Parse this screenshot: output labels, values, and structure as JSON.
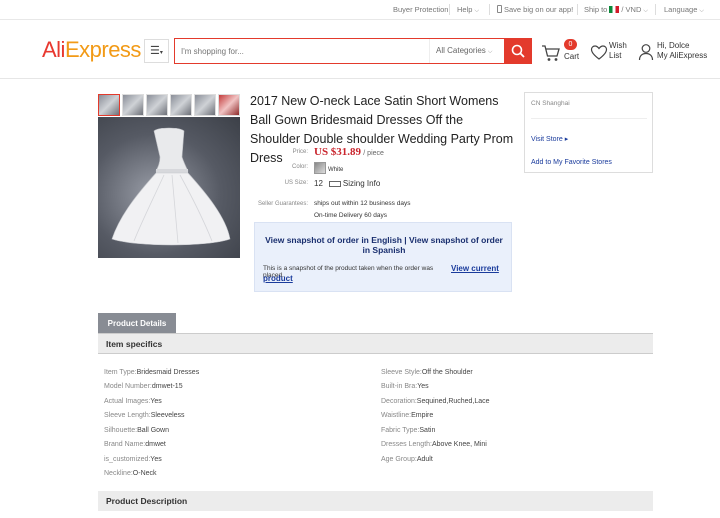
{
  "topbar": {
    "buyer_protection": "Buyer Protection",
    "help": "Help",
    "app_promo": "Save big on our app!",
    "ship_to": "Ship to",
    "ship_to_value": "/ VND",
    "language": "Language"
  },
  "header": {
    "logo_ali": "Ali",
    "logo_express": "Express",
    "category_icon": "menu-icon",
    "search_placeholder": "I'm shopping for...",
    "search_category": "All Categories",
    "cart_count": "0",
    "cart_label": "Cart",
    "wish_line1": "Wish",
    "wish_line2": "List",
    "user_greeting": "Hi, Dolce",
    "user_account": "My AliExpress"
  },
  "product": {
    "title": "2017 New O-neck Lace Satin Short Womens Ball Gown Bridesmaid Dresses Off the Shoulder Double shoulder Wedding Party Prom Dress",
    "price_label": "Price:",
    "price": "US $31.89",
    "price_unit": "/ piece",
    "color_label": "Color:",
    "color_value": "White",
    "size_label": "US Size:",
    "size_value": "12",
    "sizing_info": "Sizing Info",
    "guarantee_label": "Seller Guarantees:",
    "guarantee_1": "ships out within 12 business days",
    "guarantee_2": "On-time Delivery 60 days"
  },
  "snapshot": {
    "heading": "View snapshot of order in English | View snapshot of order in Spanish",
    "note": "This is a snapshot of the product taken when the order was placed.",
    "link": "View current product"
  },
  "seller": {
    "location": "CN Shanghai",
    "visit_store": "Visit Store ▸",
    "add_favorite": "Add to My Favorite Stores"
  },
  "details": {
    "tab": "Product Details",
    "specifics_title": "Item specifics",
    "left": [
      {
        "k": "Item Type:",
        "v": "Bridesmaid Dresses"
      },
      {
        "k": "Model Number:",
        "v": "dmwet-15"
      },
      {
        "k": "Actual Images:",
        "v": "Yes"
      },
      {
        "k": "Sleeve Length:",
        "v": "Sleeveless"
      },
      {
        "k": "Silhouette:",
        "v": "Ball Gown"
      },
      {
        "k": "Brand Name:",
        "v": "dmwet"
      },
      {
        "k": "is_customized:",
        "v": "Yes"
      },
      {
        "k": "Neckline:",
        "v": "O-Neck"
      }
    ],
    "right": [
      {
        "k": "Sleeve Style:",
        "v": "Off the Shoulder"
      },
      {
        "k": "Built-in Bra:",
        "v": "Yes"
      },
      {
        "k": "Decoration:",
        "v": "Sequined,Ruched,Lace"
      },
      {
        "k": "Waistline:",
        "v": "Empire"
      },
      {
        "k": "Fabric Type:",
        "v": "Satin"
      },
      {
        "k": "Dresses Length:",
        "v": "Above Knee, Mini"
      },
      {
        "k": "Age Group:",
        "v": "Adult"
      }
    ],
    "description_title": "Product Description"
  },
  "colors": {
    "brand_red": "#e33a2c",
    "logo_orange": "#f29a16",
    "link_blue": "#1a3b9c"
  }
}
